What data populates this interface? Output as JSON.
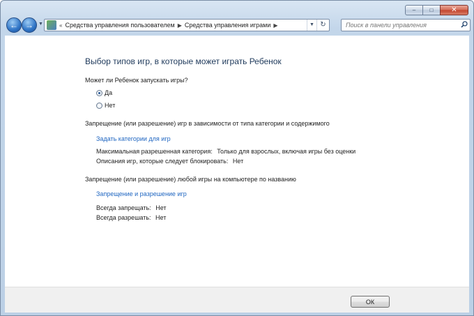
{
  "window": {
    "caption": {
      "minimize": "–",
      "maximize": "□",
      "close": "✕"
    }
  },
  "nav": {
    "back_icon": "←",
    "forward_icon": "→",
    "history_dropdown": "▼",
    "breadcrumb_overflow": "«",
    "breadcrumbs": [
      "Средства управления пользователем",
      "Средства управления играми"
    ],
    "breadcrumb_separator": "▶",
    "address_dropdown": "▼",
    "refresh_icon": "↻",
    "search": {
      "placeholder": "Поиск в панели управления",
      "value": ""
    }
  },
  "main": {
    "title": "Выбор типов игр, в которые может играть Ребенок",
    "question": "Может ли Ребенок запускать игры?",
    "options": [
      {
        "label": "Да",
        "checked": true
      },
      {
        "label": "Нет",
        "checked": false
      }
    ],
    "ratings_section": {
      "heading": "Запрещение (или разрешение) игр в зависимости от типа категории и содержимого",
      "link": "Задать категории для игр",
      "max_rating_label": "Максимальная разрешенная категория:",
      "max_rating_value": "Только для взрослых, включая игры без оценки",
      "descriptors_label": "Описания игр, которые следует блокировать:",
      "descriptors_value": "Нет"
    },
    "specific_games_section": {
      "heading": "Запрещение (или разрешение) любой игры на компьютере по названию",
      "link": "Запрещение и разрешение игр",
      "always_block_label": "Всегда запрещать:",
      "always_block_value": "Нет",
      "always_allow_label": "Всегда разрешать:",
      "always_allow_value": "Нет"
    }
  },
  "footer": {
    "ok_label": "ОК"
  }
}
